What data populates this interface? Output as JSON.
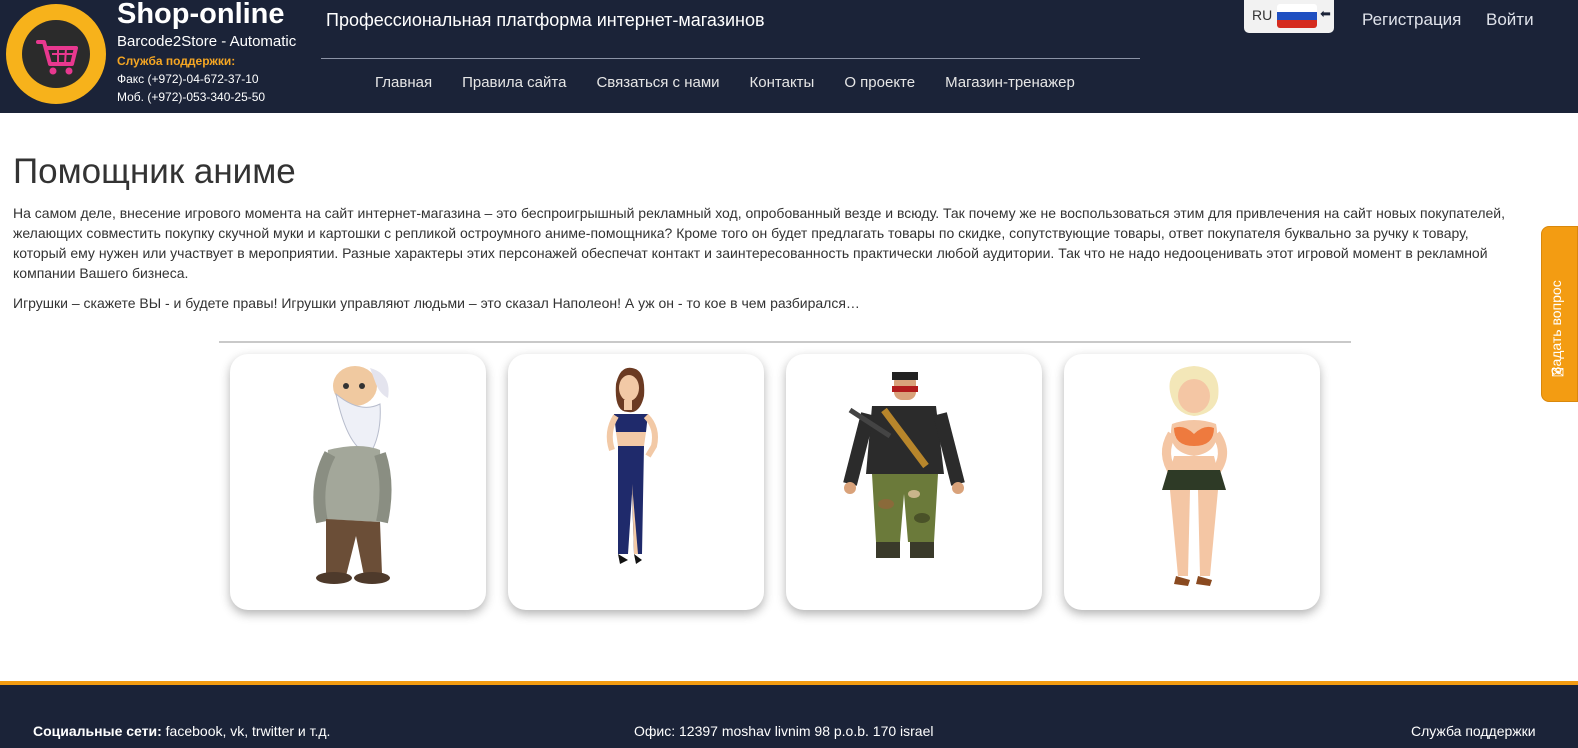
{
  "header": {
    "brand_title": "Shop-online",
    "brand_subtitle": "Barcode2Store - Automatic",
    "support_label": "Служба поддержки:",
    "fax": "Факс (+972)-04-672-37-10",
    "mobile": "Моб. (+972)-053-340-25-50",
    "tagline": "Профессиональная платформа интернет-магазинов",
    "nav": [
      "Главная",
      "Правила сайта",
      "Связаться с нами",
      "Контакты",
      "О проекте",
      "Магазин-тренажер"
    ],
    "language": "RU",
    "register": "Регистрация",
    "login": "Войти"
  },
  "main": {
    "title": "Помощник аниме",
    "paragraph1": "На самом деле, внесение игрового момента на сайт интернет-магазина – это беспроигрышный рекламный ход, опробованный везде и всюду. Так почему же не воспользоваться этим для привлечения на сайт новых покупателей, желающих совместить покупку скучной муки и картошки с репликой остроумного аниме-помощника? Кроме того он будет предлагать товары по скидке, сопутствующие товары, ответ покупателя буквально за ручку к товару, который ему нужен или участвует в мероприятии. Разные характеры этих персонажей обеспечат контакт и заинтересованность практически любой аудитории. Так что не надо недооценивать этот игровой момент в рекламной компании Вашего бизнеса.",
    "paragraph2": "Игрушки – скажете ВЫ - и будете правы! Игрушки управляют людьми – это сказал Наполеон! А уж он - то кое в чем разбирался…",
    "characters": [
      "old-man-character",
      "woman-in-blue-character",
      "soldier-character",
      "blonde-woman-character"
    ]
  },
  "feedback": {
    "label": "Задать вопрос",
    "icon": "envelope-icon"
  },
  "footer": {
    "social_label": "Социальные сети:",
    "social_text": " facebook, vk, trwitter и т.д.",
    "office": "Офис: 12397 moshav livnim 98 p.o.b. 170 israel",
    "support": "Служба поддержки"
  },
  "colors": {
    "header_bg": "#1b2338",
    "accent": "#f39c12",
    "logo_ring": "#f7b21b",
    "cart_pink": "#e8388f"
  }
}
